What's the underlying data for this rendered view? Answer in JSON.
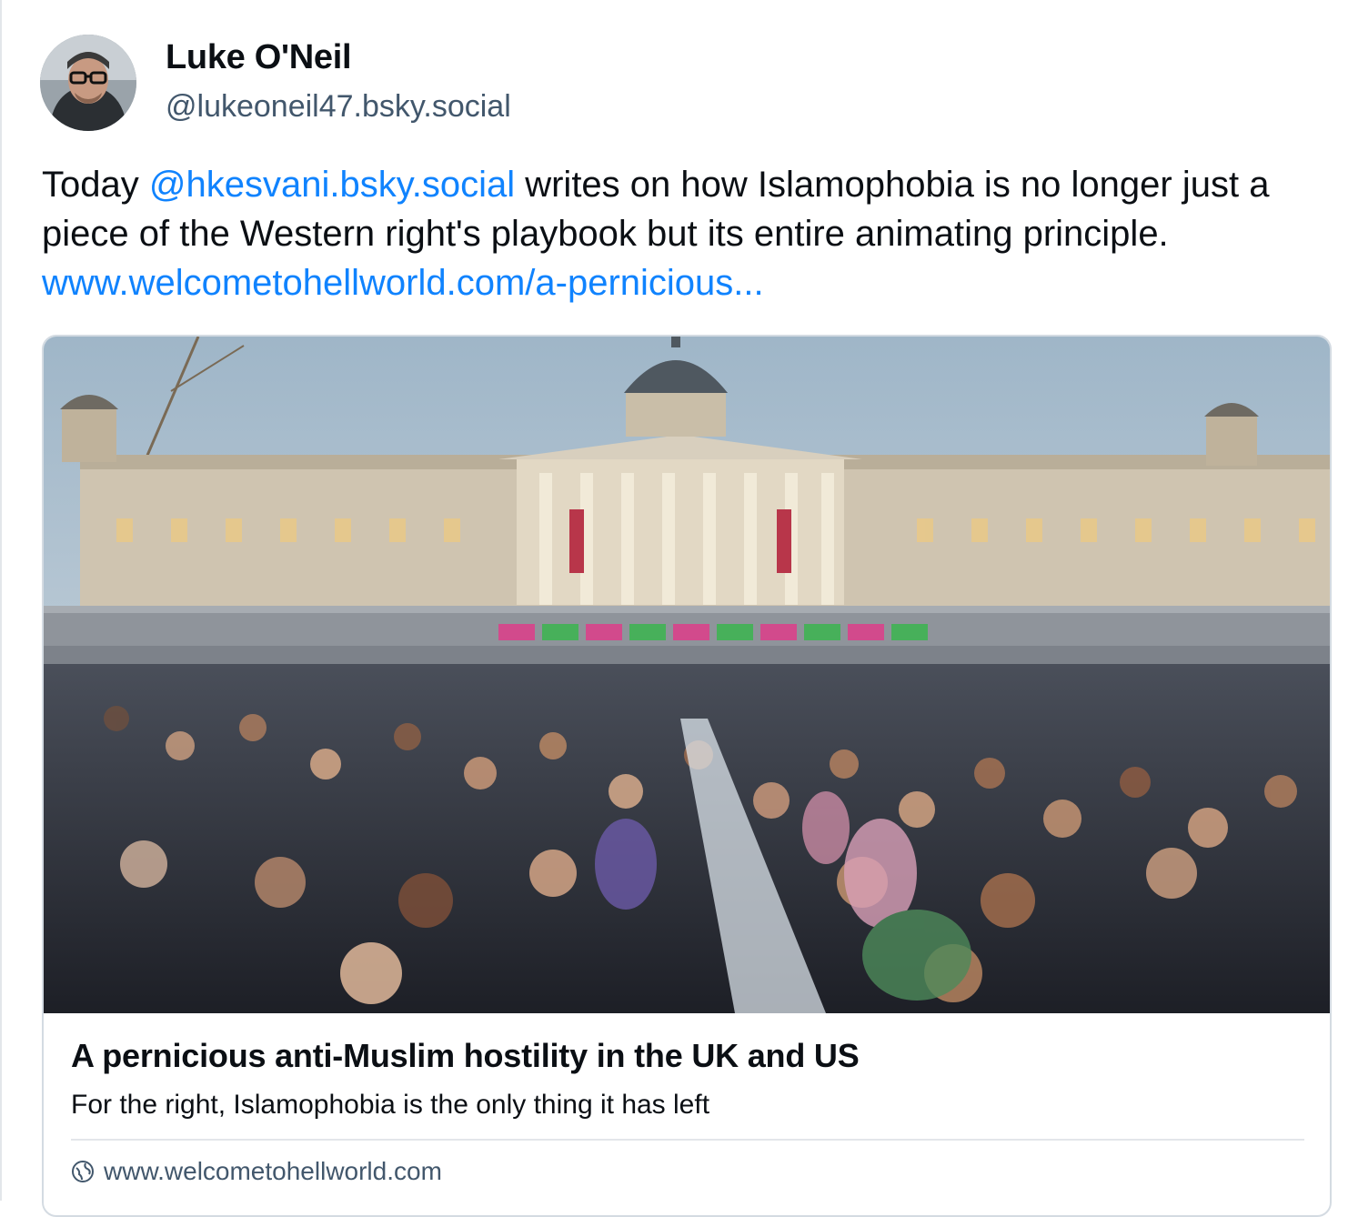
{
  "author": {
    "display_name": "Luke O'Neil",
    "handle": "@lukeoneil47.bsky.social",
    "avatar_icon": "avatar-photo"
  },
  "post": {
    "text_before": "Today ",
    "mention": "@hkesvani.bsky.social",
    "text_middle": " writes on how Islamophobia is no longer just a piece of the Western right's playbook but its entire animating principle. ",
    "link": "www.welcometohellworld.com/a-pernicious..."
  },
  "embed": {
    "image_icon": "trafalgar-square-iftar-photo",
    "title": "A pernicious anti-Muslim hostility in the UK and US",
    "description": "For the right, Islamophobia is the only thing it has left",
    "domain": "www.welcometohellworld.com",
    "domain_icon": "globe-icon"
  },
  "colors": {
    "link": "#1083fe",
    "handle": "#42576c",
    "border": "#d4dbe2"
  }
}
